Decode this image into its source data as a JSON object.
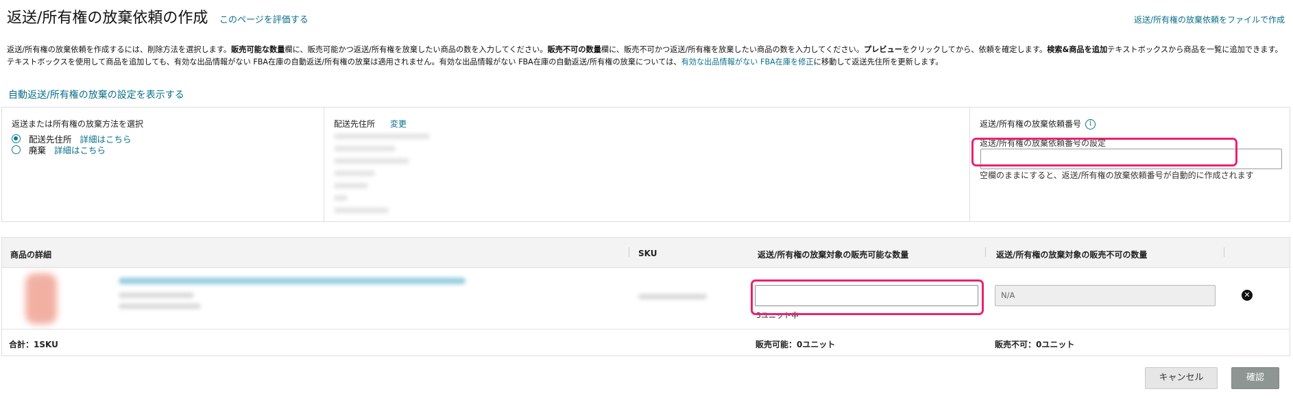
{
  "header": {
    "title": "返送/所有権の放棄依頼の作成",
    "rate_link": "このページを評価する",
    "file_link": "返送/所有権の放棄依頼をファイルで作成"
  },
  "intro": {
    "p1": "返送/所有権の放棄依頼を作成するには、削除方法を選択します。",
    "b1": "販売可能な数量",
    "p2": "欄に、販売可能かつ返送/所有権を放棄したい商品の数を入力してください。",
    "b2": "販売不可の数量",
    "p3": "欄に、販売不可かつ返送/所有権を放棄したい商品の数を入力してください。",
    "b3": "プレビュー",
    "p4": "をクリックしてから、依頼を確定します。",
    "b4": "検索&商品を追加",
    "p5": "テキストボックスから商品を一覧に追加できます。テキストボックスを使用して商品を追加しても、有効な出品情報がない FBA在庫の自動返送/所有権の放棄は適用されません。有効な出品情報がない FBA在庫の自動返送/所有権の放棄については、",
    "link": "有効な出品情報がない FBA在庫を修正",
    "p6": "に移動して返送先住所を更新します。"
  },
  "show_settings_link": "自動返送/所有権の放棄の設定を表示する",
  "method": {
    "title": "返送または所有権の放棄方法を選択",
    "options": [
      {
        "label": "配送先住所",
        "details": "詳細はこちら",
        "selected": true
      },
      {
        "label": "廃棄",
        "details": "詳細はこちら",
        "selected": false
      }
    ]
  },
  "address": {
    "title": "配送先住所",
    "change_link": "変更"
  },
  "order_id": {
    "title": "返送/所有権の放棄依頼番号",
    "info_icon": "info-icon",
    "label": "返送/所有権の放棄依頼番号の設定",
    "value": "",
    "hint": "空欄のままにすると、返送/所有権の放棄依頼番号が自動的に作成されます"
  },
  "table": {
    "headers": {
      "details": "商品の詳細",
      "sku": "SKU",
      "sellable": "返送/所有権の放棄対象の販売可能な数量",
      "unsellable": "返送/所有権の放棄対象の販売不可の数量"
    },
    "row": {
      "sellable_value": "",
      "sellable_note": "3ユニット中",
      "unsellable_value": "N/A",
      "remove_icon": "close-circle-icon"
    },
    "totals": {
      "sku_total": "合計：1SKU",
      "sellable_total": "販売可能：0ユニット",
      "unsellable_total": "販売不可：0ユニット"
    }
  },
  "buttons": {
    "cancel": "キャンセル",
    "confirm": "確認"
  },
  "colors": {
    "link": "#0a6f89",
    "highlight": "#e9226f",
    "confirm_bg": "#8d9693"
  }
}
